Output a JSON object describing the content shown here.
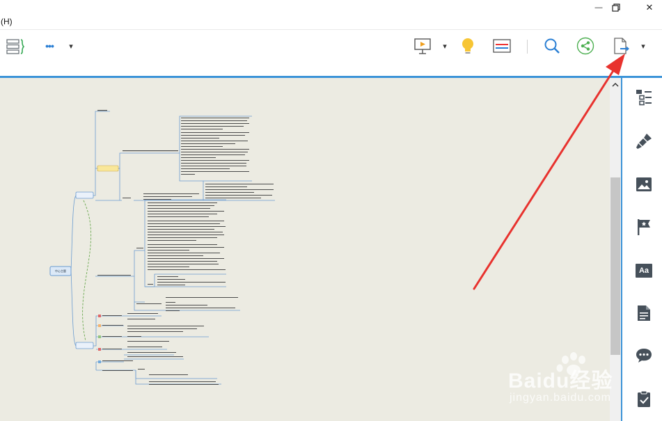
{
  "window": {
    "minimize_glyph": "—",
    "restore_glyph": "❐",
    "close_glyph": "✕"
  },
  "menu": {
    "help_label": "(H)"
  },
  "toolbar": {
    "more_glyph": "•••",
    "dropdown_glyph": "▾",
    "icons": [
      "outline-icon",
      "more-icon",
      "presentation-icon",
      "idea-icon",
      "theme-icon",
      "search-icon",
      "share-icon",
      "export-icon"
    ]
  },
  "right_panel": {
    "icons": [
      "outline-list-icon",
      "format-brush-icon",
      "image-icon",
      "marker-flag-icon",
      "text-style-icon",
      "notes-icon",
      "comments-icon",
      "task-icon"
    ],
    "text_style_label": "Aa"
  },
  "mindmap": {
    "central_node": "中心主题"
  },
  "watermark": {
    "brand": "Baidu经验",
    "url": "jingyan.baidu.com"
  },
  "colors": {
    "accent": "#3c94d8",
    "canvas_bg": "#ecebe2",
    "arrow": "#e8322e",
    "icon_dark": "#46505a"
  }
}
